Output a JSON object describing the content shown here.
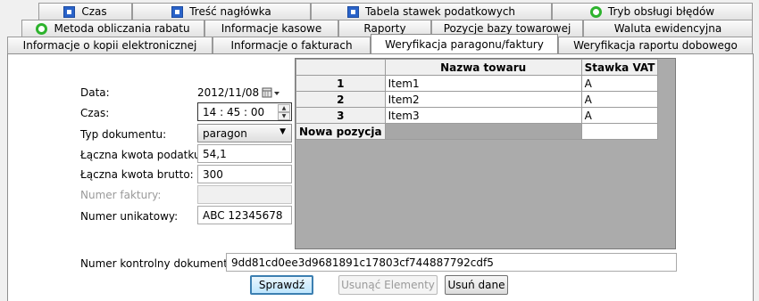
{
  "tabs": {
    "row1": [
      {
        "label": "Czas",
        "icon": "square-icon"
      },
      {
        "label": "Treść nagłówka",
        "icon": "square-icon"
      },
      {
        "label": "Tabela stawek podatkowych",
        "icon": "square-icon"
      },
      {
        "label": "Tryb obsługi błędów",
        "icon": "circle-icon"
      }
    ],
    "row2": [
      {
        "label": "Metoda obliczania rabatu",
        "icon": "circle-icon"
      },
      {
        "label": "Informacje kasowe"
      },
      {
        "label": "Raporty"
      },
      {
        "label": "Pozycje bazy towarowej"
      },
      {
        "label": "Waluta ewidencyjna"
      }
    ],
    "row3": [
      {
        "label": "Informacje o kopii elektronicznej"
      },
      {
        "label": "Informacje o fakturach"
      },
      {
        "label": "Weryfikacja paragonu/faktury",
        "active": true
      },
      {
        "label": "Weryfikacja raportu dobowego"
      }
    ]
  },
  "form": {
    "data_label": "Data:",
    "data_value": "2012/11/08",
    "czas_label": "Czas:",
    "czas_value": "14 : 45 : 00",
    "typ_label": "Typ dokumentu:",
    "typ_value": "paragon",
    "podatek_label": "Łączna kwota podatku:",
    "podatek_value": "54,1",
    "brutto_label": "Łączna kwota brutto:",
    "brutto_value": "300",
    "faktura_label": "Numer faktury:",
    "faktura_value": "",
    "unikatowy_label": "Numer unikatowy:",
    "unikatowy_value": "ABC 12345678",
    "kontrolny_label": "Numer kontrolny dokumentu:",
    "kontrolny_value": "9dd81cd0ee3d9681891c17803cf744887792cdf5"
  },
  "grid": {
    "columns": [
      "Nazwa towaru",
      "Stawka VAT"
    ],
    "rows": [
      {
        "num": "1",
        "name": "Item1",
        "vat": "A"
      },
      {
        "num": "2",
        "name": "Item2",
        "vat": "A"
      },
      {
        "num": "3",
        "name": "Item3",
        "vat": "A"
      }
    ],
    "new_row_label": "Nowa pozycja"
  },
  "buttons": {
    "sprawdz": "Sprawdź",
    "usun_elementy": "Usunąć Elementy",
    "usun_dane": "Usuń dane"
  },
  "colors": {
    "square_icon": "#2a63c9",
    "circle_icon": "#2db32d",
    "primary_button_border": "#3c7fb1"
  }
}
